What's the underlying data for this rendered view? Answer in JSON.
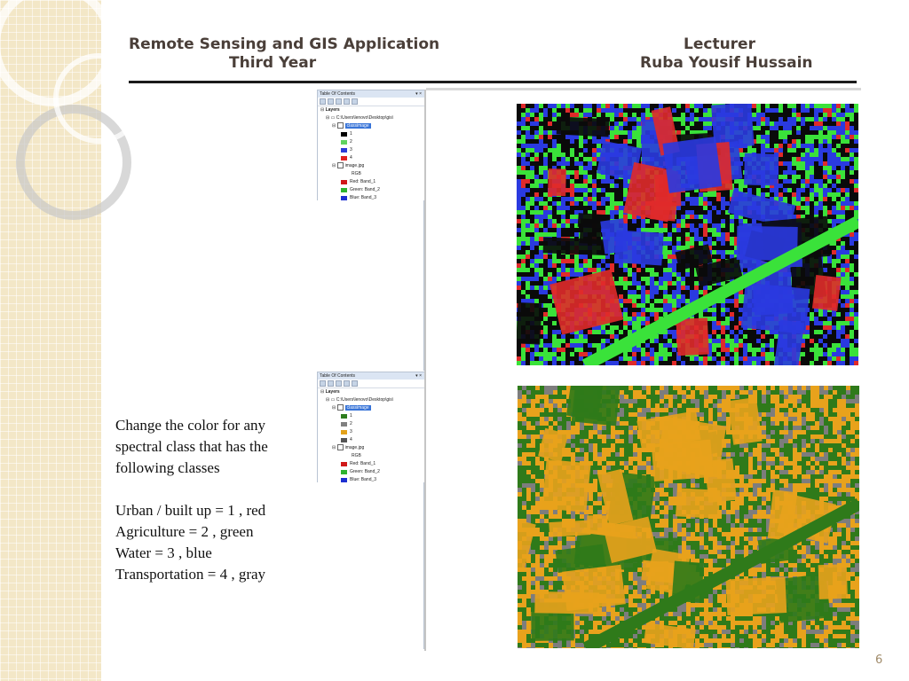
{
  "header": {
    "course_title": "Remote Sensing and GIS Application",
    "year": "Third Year",
    "role": "Lecturer",
    "lecturer_name": "Ruba Yousif Hussain"
  },
  "toc_top": {
    "panel_title": "Table Of Contents",
    "root_label": "Layers",
    "folder_path": "C:\\Users\\lenovo\\Desktop\\gis\\",
    "class_layer": "classimage",
    "classes": [
      {
        "label": "1",
        "color": "#000000"
      },
      {
        "label": "2",
        "color": "#5fd35f"
      },
      {
        "label": "3",
        "color": "#2b3bd6"
      },
      {
        "label": "4",
        "color": "#e02020"
      }
    ],
    "image_layer": "image.jpg",
    "image_mode": "RGB",
    "bands": [
      {
        "channel": "Red:",
        "band": "Band_1",
        "color": "#d01818"
      },
      {
        "channel": "Green:",
        "band": "Band_2",
        "color": "#2fb32f"
      },
      {
        "channel": "Blue:",
        "band": "Band_3",
        "color": "#1d2fd1"
      }
    ]
  },
  "toc_bottom": {
    "panel_title": "Table Of Contents",
    "root_label": "Layers",
    "folder_path": "C:\\Users\\lenovo\\Desktop\\gis\\",
    "class_layer": "classimage",
    "classes": [
      {
        "label": "1",
        "color": "#2e7d1e"
      },
      {
        "label": "2",
        "color": "#808080"
      },
      {
        "label": "3",
        "color": "#e3a21a"
      },
      {
        "label": "4",
        "color": "#555555"
      }
    ],
    "image_layer": "image.jpg",
    "image_mode": "RGB",
    "bands": [
      {
        "channel": "Red:",
        "band": "Band_1",
        "color": "#d01818"
      },
      {
        "channel": "Green:",
        "band": "Band_2",
        "color": "#2fb32f"
      },
      {
        "channel": "Blue:",
        "band": "Band_3",
        "color": "#1d2fd1"
      }
    ]
  },
  "map_top_palette": [
    "#0a0a0a",
    "#3ae23a",
    "#2a3ae0",
    "#e02a2a"
  ],
  "map_bottom_palette": [
    "#2f7a1a",
    "#7d7d7d",
    "#e8a21c"
  ],
  "instructions": {
    "line1": "Change the color for any",
    "line2": "spectral  class that has the",
    "line3": "following classes",
    "class1": "Urban / built up = 1 , red",
    "class2": "Agriculture = 2 , green",
    "class3": "Water = 3 , blue",
    "class4": "Transportation = 4 , gray"
  },
  "page_number": "6"
}
